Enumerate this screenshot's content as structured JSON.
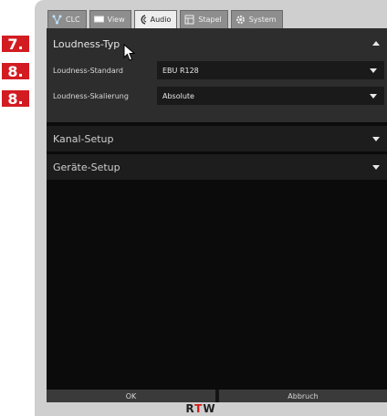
{
  "tabs": [
    {
      "label": "CLC",
      "icon": "network-icon",
      "active": false
    },
    {
      "label": "View",
      "icon": "monitor-icon",
      "active": false
    },
    {
      "label": "Audio",
      "icon": "audio-icon",
      "active": true
    },
    {
      "label": "Stapel",
      "icon": "stack-icon",
      "active": false
    },
    {
      "label": "System",
      "icon": "gear-icon",
      "active": false
    }
  ],
  "loudness_type": {
    "title": "Loudness-Typ",
    "standard_label": "Loudness-Standard",
    "standard_value": "EBU R128",
    "scaling_label": "Loudness-Skalierung",
    "scaling_value": "Absolute"
  },
  "sections": {
    "channel_setup": "Kanal-Setup",
    "device_setup": "Geräte-Setup"
  },
  "buttons": {
    "ok": "OK",
    "cancel": "Abbruch"
  },
  "brand": {
    "left": "R",
    "mid": "T",
    "right": "W"
  },
  "callouts": [
    "7.",
    "8.",
    "8."
  ],
  "colors": {
    "callout": "#d21c22",
    "panel": "#2d2d2d",
    "background": "#0b0b0b"
  }
}
